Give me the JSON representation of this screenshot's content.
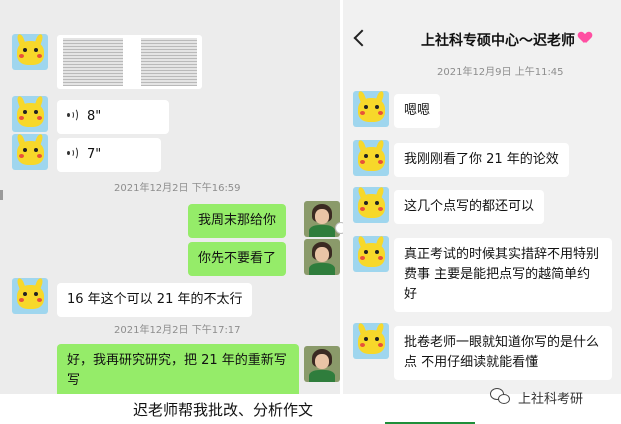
{
  "left_chat": {
    "voice_messages": [
      {
        "duration": "8\""
      },
      {
        "duration": "7\""
      }
    ],
    "timestamp_1": "2021年12月2日 下午16:59",
    "sent_1": "我周末那给你",
    "sent_2": "你先不要看了",
    "received_1": "16 年这个可以  21 年的不太行",
    "timestamp_2": "2021年12月2日 下午17:17",
    "sent_3": "好，我再研究研究，把 21 年的重新写写"
  },
  "right_chat": {
    "title": "上社科专硕中心～迟老师",
    "timestamp": "2021年12月9日 上午11:45",
    "messages": [
      "嗯嗯",
      "我刚刚看了你 21 年的论效",
      "这几个点写的都还可以",
      "真正考试的时候其实措辞不用特别费事  主要是能把点写的越简单约好",
      "批卷老师一眼就知道你写的是什么点  不用仔细读就能看懂"
    ]
  },
  "caption": "迟老师帮我批改、分析作文",
  "watermark": "上社科考研",
  "colors": {
    "chat_background": "#ececec",
    "sent_bubble": "#95ec69",
    "received_bubble": "#ffffff",
    "caption_underline": "#1f8f3a"
  }
}
